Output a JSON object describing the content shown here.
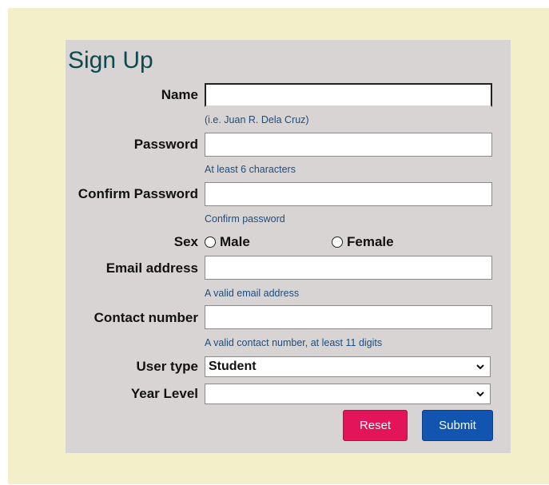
{
  "form": {
    "title": "Sign Up",
    "fields": {
      "name": {
        "label": "Name",
        "value": "",
        "hint": "(i.e. Juan R. Dela Cruz)"
      },
      "password": {
        "label": "Password",
        "value": "",
        "hint": "At least 6 characters"
      },
      "confirm_password": {
        "label": "Confirm Password",
        "value": "",
        "hint": "Confirm password"
      },
      "sex": {
        "label": "Sex",
        "options": [
          "Male",
          "Female"
        ],
        "selected": ""
      },
      "email": {
        "label": "Email address",
        "value": "",
        "hint": "A valid email address"
      },
      "contact": {
        "label": "Contact number",
        "value": "",
        "hint": "A valid contact number, at least 11 digits"
      },
      "user_type": {
        "label": "User type",
        "selected": "Student"
      },
      "year_level": {
        "label": "Year Level",
        "selected": ""
      }
    },
    "buttons": {
      "reset": "Reset",
      "submit": "Submit"
    }
  },
  "colors": {
    "page_background": "#f3efc8",
    "panel_background": "#d8d4d4",
    "title": "#0c4a4f",
    "hint": "#1f4d7a",
    "reset_button": "#e4145a",
    "submit_button": "#1155b0"
  },
  "icons": {
    "dropdown": "chevron-down-icon",
    "radio": "radio-unchecked-icon"
  }
}
